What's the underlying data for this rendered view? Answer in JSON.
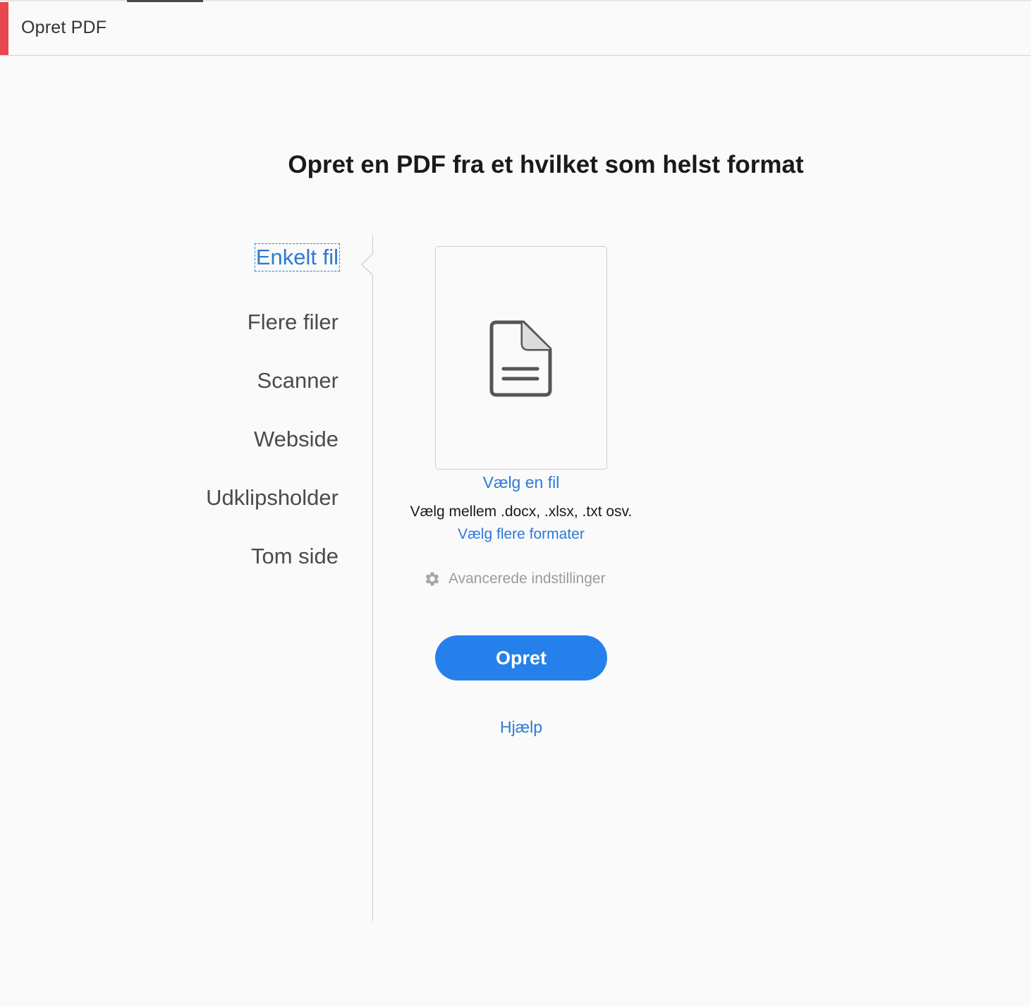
{
  "header": {
    "title": "Opret PDF",
    "accent_color": "#e8474f"
  },
  "main": {
    "title": "Opret en PDF fra et hvilket som helst format"
  },
  "tabs": [
    {
      "label": "Enkelt fil",
      "active": true
    },
    {
      "label": "Flere filer",
      "active": false
    },
    {
      "label": "Scanner",
      "active": false
    },
    {
      "label": "Webside",
      "active": false
    },
    {
      "label": "Udklipsholder",
      "active": false
    },
    {
      "label": "Tom side",
      "active": false
    }
  ],
  "file_panel": {
    "icon": "document-icon",
    "choose_file_label": "Vælg en fil",
    "formats_text": "Vælg mellem .docx, .xlsx, .txt osv.",
    "more_formats_label": "Vælg flere formater",
    "advanced_icon": "gear-icon",
    "advanced_label": "Avancerede indstillinger"
  },
  "actions": {
    "create_label": "Opret",
    "help_label": "Hjælp"
  },
  "colors": {
    "link": "#2c7ad6",
    "primary_button": "#2680eb",
    "background": "#fafafa"
  }
}
